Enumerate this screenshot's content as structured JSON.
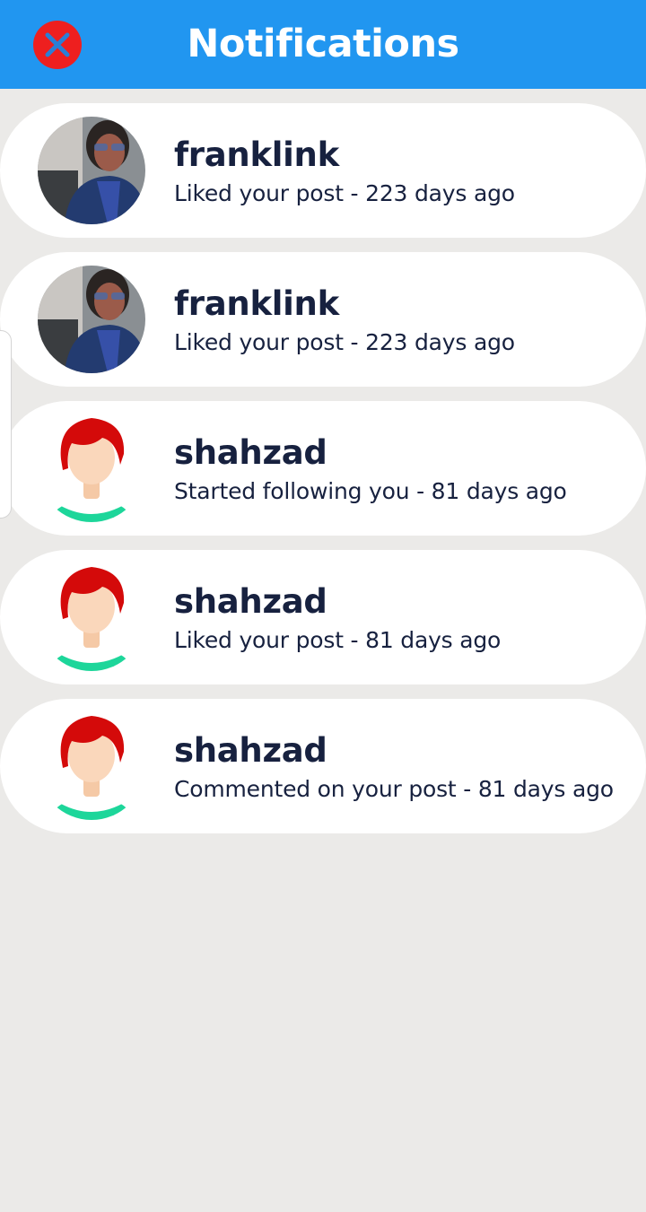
{
  "header": {
    "title": "Notifications",
    "background_color": "#2196f0",
    "close_icon": "close-icon"
  },
  "colors": {
    "close_button": "#ee1f1f",
    "card_background": "#ffffff",
    "page_background": "#ebeae8",
    "text": "#17213f"
  },
  "notifications": [
    {
      "name": "franklink",
      "message": "Liked your post - 223 days ago",
      "avatar": "photo"
    },
    {
      "name": "franklink",
      "message": "Liked your post - 223 days ago",
      "avatar": "photo"
    },
    {
      "name": "shahzad",
      "message": "Started following you - 81 days ago",
      "avatar": "default"
    },
    {
      "name": "shahzad",
      "message": "Liked your post - 81 days ago",
      "avatar": "default"
    },
    {
      "name": "shahzad",
      "message": "Commented on your post - 81 days ago",
      "avatar": "default"
    }
  ]
}
